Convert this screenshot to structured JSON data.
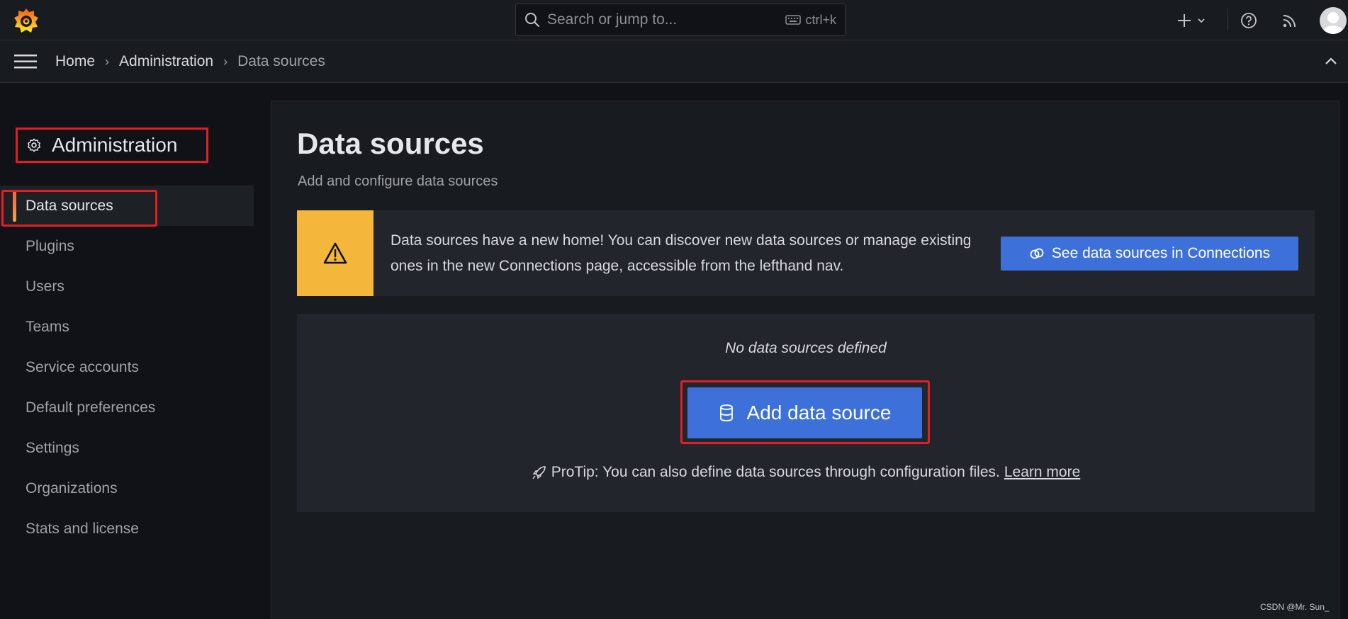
{
  "header": {
    "search_placeholder": "Search or jump to...",
    "shortcut": "ctrl+k"
  },
  "breadcrumb": {
    "items": [
      "Home",
      "Administration",
      "Data sources"
    ],
    "separator": "›"
  },
  "sidebar": {
    "title": "Administration",
    "items": [
      {
        "label": "Data sources",
        "active": true
      },
      {
        "label": "Plugins"
      },
      {
        "label": "Users"
      },
      {
        "label": "Teams"
      },
      {
        "label": "Service accounts"
      },
      {
        "label": "Default preferences"
      },
      {
        "label": "Settings"
      },
      {
        "label": "Organizations"
      },
      {
        "label": "Stats and license"
      }
    ]
  },
  "main": {
    "title": "Data sources",
    "subtitle": "Add and configure data sources",
    "alert": {
      "message": "Data sources have a new home! You can discover new data sources or manage existing ones in the new Connections page, accessible from the lefthand nav.",
      "button_label": "See data sources in Connections"
    },
    "empty_state": {
      "message": "No data sources defined",
      "button_label": "Add data source",
      "protip": "ProTip: You can also define data sources through configuration files.",
      "link_label": "Learn more"
    }
  },
  "watermark": "CSDN @Mr. Sun_",
  "colors": {
    "background": "#111217",
    "panel": "#181b1f",
    "primary_button": "#3d71d9",
    "warning": "#f5b73b",
    "annotation_red": "#e31e24",
    "active_accent": "#f55f3e"
  }
}
